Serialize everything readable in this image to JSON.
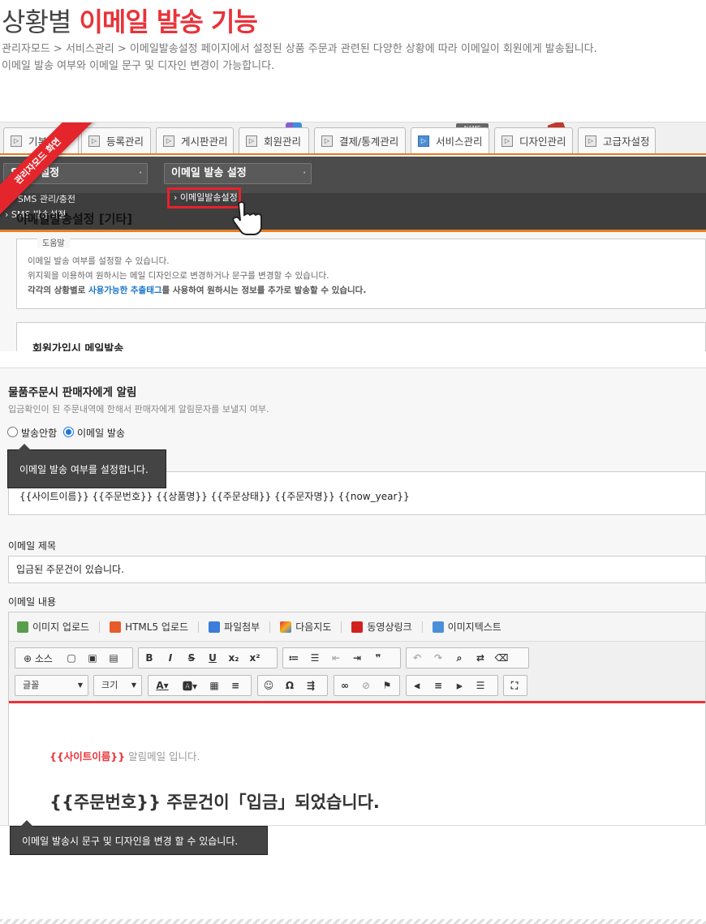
{
  "heading": {
    "plain": "상황별",
    "highlight": "이메일 발송 기능"
  },
  "description": [
    "관리자모드 > 서비스관리 > 이메일발송설정 페이지에서 설정된 상품 주문과 관련된 다양한 상황에 따라 이메일이 회원에게 발송됩니다.",
    "이메일 발송 여부와 이메일 문구 및 디자인 변경이 가능합니다."
  ],
  "admin": {
    "ribbon": "관리자모드 화면",
    "tabs": [
      "기본",
      "등록관리",
      "게시판관리",
      "회원관리",
      "결제/통계관리",
      "서비스관리",
      "디자인관리",
      "고급자설정"
    ],
    "active_tab": "서비스관리",
    "dark_menu": {
      "left": "SMS 설정",
      "right": "이메일 발송 설정"
    },
    "sub_left": [
      "SMS 관리/충전",
      "SMS 발송설정"
    ],
    "sub_right": "이메일발송설정",
    "page_heading": "이메일발송설정 [기타]",
    "help": {
      "legend": "도움말",
      "lines": [
        "이메일 발송 여부를 설정할 수 있습니다.",
        "위지윅을 이용하여 원하시는 메일 디자인으로 변경하거나 문구를 변경할 수 있습니다."
      ],
      "line3": {
        "pre": "각각의 상황별로 ",
        "link": "사용가능한 추출태그",
        "post": "를 사용하여 원하시는 정보를 추가로 발송할 수 있습니다."
      }
    },
    "section_title": "회원가입시 메일발송"
  },
  "settings": {
    "title": "물품주문시 판매자에게 알림",
    "subtitle": "입금확인이 된 주문내역에 한해서 판매자에게 알림문자를 보낼지 여부.",
    "radio_off": "발송안함",
    "radio_on": "이메일 발송",
    "tooltip1": "이메일 발송 여부를 설정합니다.",
    "tags": "{{사이트이름}} {{주문번호}} {{상품명}} {{주문상태}} {{주문자명}} {{now_year}}",
    "subject_label": "이메일 제목",
    "subject_value": "입금된 주문건이 있습니다.",
    "content_label": "이메일 내용",
    "uploads": [
      "이미지 업로드",
      "HTML5 업로드",
      "파일첨부",
      "다음지도",
      "동영상링크",
      "이미지텍스트"
    ],
    "toolbar": {
      "source": "소스",
      "font": "글꼴",
      "size": "크기"
    },
    "body_site": "{{사이트이름}}",
    "body_site_suffix": " 알림메일 입니다.",
    "body_heading": "{{주문번호}} 주문건이「입금」되었습니다.",
    "tooltip2": "이메일 발송시 문구 및 디자인을 변경 할 수 있습니다."
  },
  "colors": {
    "accent": "#e8333a",
    "orange": "#e87d1e",
    "link": "#1a73c9"
  }
}
